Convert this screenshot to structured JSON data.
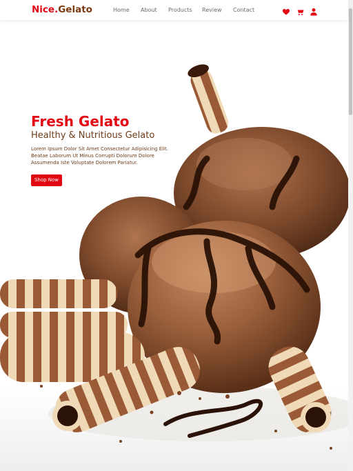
{
  "header": {
    "logo": {
      "part1": "Nice.",
      "part2": "Gelato"
    },
    "nav": [
      {
        "label": "Home"
      },
      {
        "label": "About"
      },
      {
        "label": "Products"
      },
      {
        "label": "Review"
      },
      {
        "label": "Contact"
      }
    ],
    "icons": [
      "heart-icon",
      "cart-icon",
      "user-icon"
    ]
  },
  "hero": {
    "title": "Fresh Gelato",
    "subtitle": "Healthy & Nutritious Gelato",
    "description": "Lorem Ipsum Dolor Sit Amet Consectetur Adipisicing Elit. Beatae Laborum Ut Minus Corrupti Dolorum Dolore Assumenda Iste Voluptate Dolorem Pariatur.",
    "cta": "Shop Now"
  },
  "colors": {
    "accent": "#e30613",
    "brown": "#6e3a17"
  }
}
